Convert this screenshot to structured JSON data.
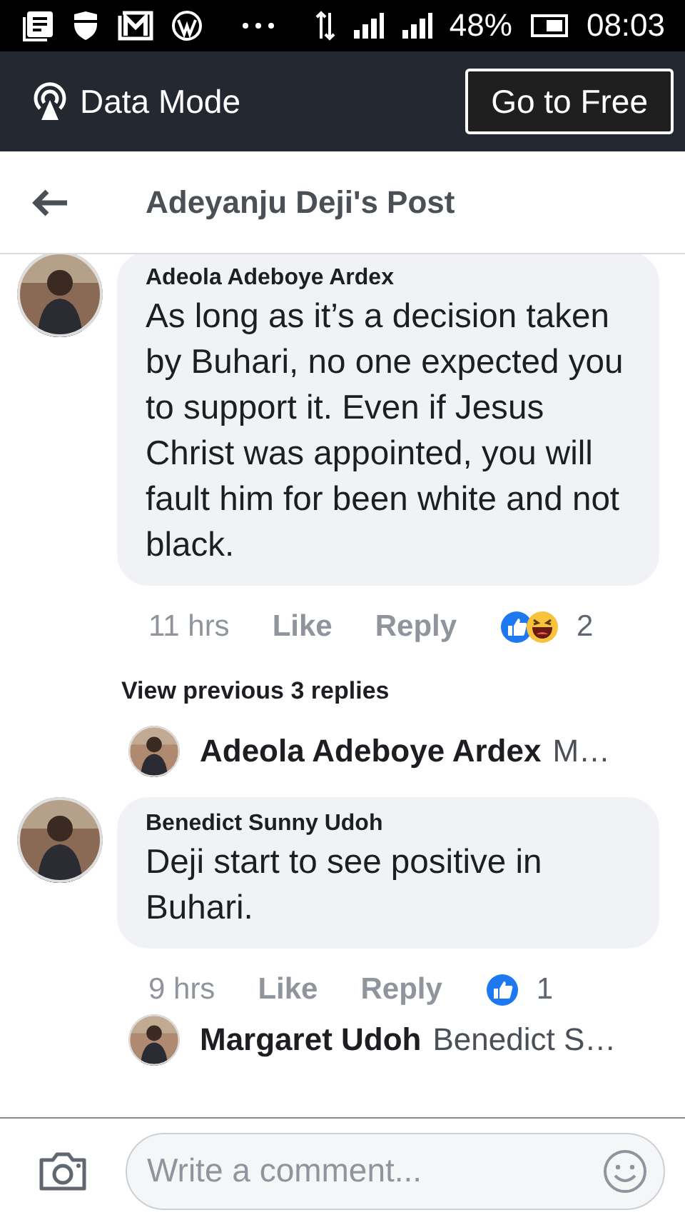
{
  "status_bar": {
    "battery": "48%",
    "time": "08:03"
  },
  "data_bar": {
    "label": "Data Mode",
    "button": "Go to Free"
  },
  "header": {
    "title": "Adeyanju Deji's Post"
  },
  "thread": [
    {
      "kind": "comment",
      "author": "Adeola Adeboye Ardex",
      "text": "As long as it’s a decision taken by Buhari, no one expected you to support it. Even if Jesus Christ was appointed, you will fault him for been white and not black.",
      "time": "11 hrs",
      "like": "Like",
      "reply": "Reply",
      "reactions": [
        {
          "kind": "like"
        },
        {
          "kind": "haha"
        }
      ],
      "reaction_count": "2"
    },
    {
      "kind": "more_link",
      "text": "View previous 3 replies"
    },
    {
      "kind": "reply_preview",
      "author": "Adeola Adeboye Ardex",
      "snippet": "M…"
    },
    {
      "kind": "comment",
      "author": "Benedict Sunny Udoh",
      "text": "Deji start to see positive in Buhari.",
      "time": "9 hrs",
      "like": "Like",
      "reply": "Reply",
      "reactions": [
        {
          "kind": "like"
        }
      ],
      "reaction_count": "1"
    },
    {
      "kind": "reply_preview",
      "author": "Margaret Udoh",
      "snippet": "Benedict S…"
    }
  ],
  "composer": {
    "placeholder": "Write a comment..."
  }
}
